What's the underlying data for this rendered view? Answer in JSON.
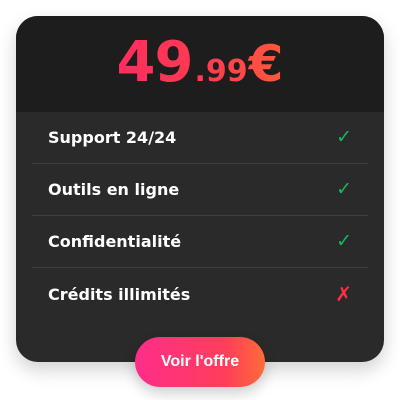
{
  "price": {
    "integer": "49",
    "decimal": ".99",
    "currency": "€"
  },
  "features": [
    {
      "label": "Support 24/24",
      "included": true,
      "mark": "✓"
    },
    {
      "label": "Outils en ligne",
      "included": true,
      "mark": "✓"
    },
    {
      "label": "Confidentialité",
      "included": true,
      "mark": "✓"
    },
    {
      "label": "Crédits illimités",
      "included": false,
      "mark": "✗"
    }
  ],
  "cta": {
    "label": "Voir l'offre"
  },
  "colors": {
    "card_bg": "#2a2a2a",
    "header_bg": "#1d1d1d",
    "accent_start": "#ff2d60",
    "accent_end": "#ff5a3c",
    "check": "#17b85a",
    "cross": "#ff2f46"
  },
  "icons": {
    "included": "checkmark-icon",
    "excluded": "cross-icon"
  }
}
